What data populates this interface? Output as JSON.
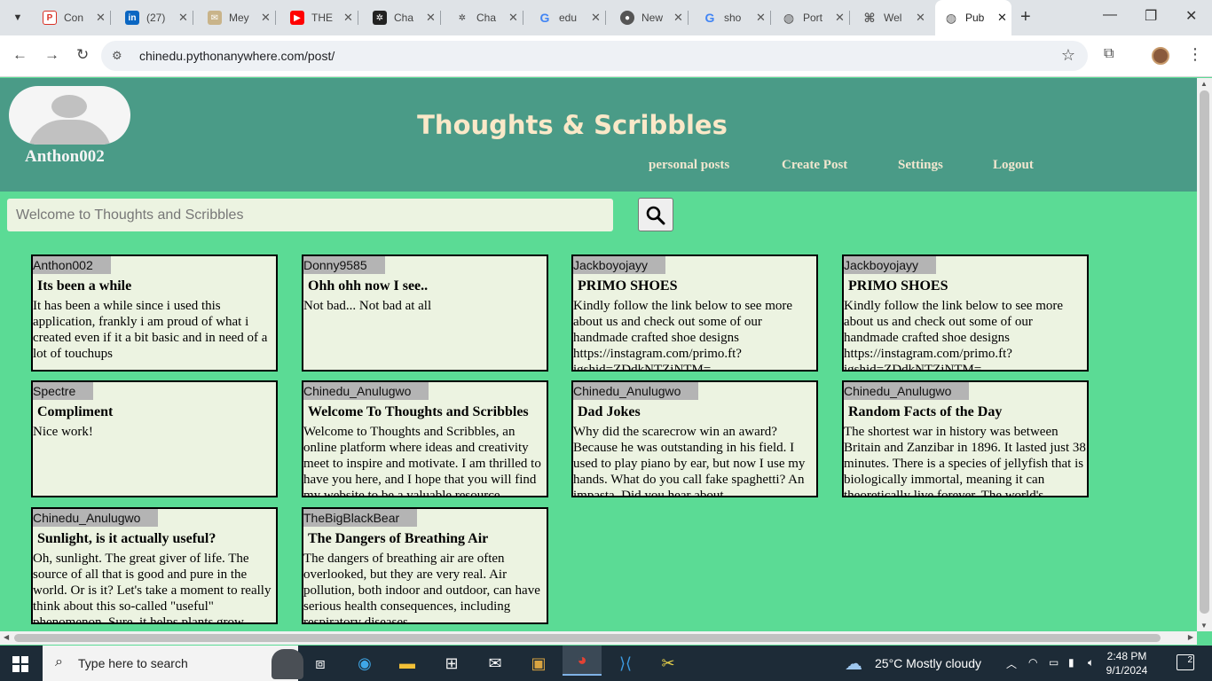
{
  "browser": {
    "tabs": [
      {
        "title": "Con",
        "icon": "pdf-icon",
        "color": "#d93025"
      },
      {
        "title": "(27)",
        "icon": "linkedin-icon",
        "color": "#0a66c2"
      },
      {
        "title": "Mey",
        "icon": "mail-icon",
        "color": "#c9b48a"
      },
      {
        "title": "THE",
        "icon": "youtube-icon",
        "color": "#ff0000"
      },
      {
        "title": "Cha",
        "icon": "chatgpt-icon",
        "color": "#222222"
      },
      {
        "title": "Cha",
        "icon": "chatgpt-icon",
        "color": "#555555"
      },
      {
        "title": "edu",
        "icon": "google-icon",
        "color": "#4285f4"
      },
      {
        "title": "New",
        "icon": "chrome-icon",
        "color": "#555555"
      },
      {
        "title": "sho",
        "icon": "google-icon",
        "color": "#4285f4"
      },
      {
        "title": "Port",
        "icon": "globe-icon",
        "color": "#555555"
      },
      {
        "title": "Wel",
        "icon": "replit-icon",
        "color": "#555555"
      },
      {
        "title": "Pub",
        "icon": "globe-icon",
        "color": "#555555",
        "active": true
      }
    ],
    "url": "chinedu.pythonanywhere.com/post/"
  },
  "header": {
    "username": "Anthon002",
    "site_title": "Thoughts & Scribbles",
    "nav": [
      "personal posts",
      "Create Post",
      "Settings",
      "Logout"
    ]
  },
  "search": {
    "placeholder": "Welcome to Thoughts and Scribbles"
  },
  "posts": [
    {
      "author": "Anthon002",
      "title": "Its been a while",
      "body": "It has been a while since i used this application, frankly i am proud of what i created even if it a bit basic and in need of a lot of touchups"
    },
    {
      "author": "Donny9585",
      "title": "Ohh ohh now I see..",
      "body": "Not bad... Not bad at all"
    },
    {
      "author": "Jackboyojayy",
      "title": "PRIMO SHOES",
      "body": "Kindly follow the link below to see more about us and check out some of our handmade crafted shoe designs https://instagram.com/primo.ft?igshid=ZDdkNTZiNTM="
    },
    {
      "author": "Jackboyojayy",
      "title": "PRIMO SHOES",
      "body": "Kindly follow the link below to see more about us and check out some of our handmade crafted shoe designs https://instagram.com/primo.ft?igshid=ZDdkNTZiNTM="
    },
    {
      "author": "Spectre",
      "title": "Compliment",
      "body": "Nice work!"
    },
    {
      "author": "Chinedu_Anulugwo",
      "title": "Welcome To Thoughts and Scribbles",
      "body": "Welcome to Thoughts and Scribbles, an online platform where ideas and creativity meet to inspire and motivate. I am thrilled to have you here, and I hope that you will find my website to be a valuable resource"
    },
    {
      "author": "Chinedu_Anulugwo",
      "title": "Dad Jokes",
      "body": "Why did the scarecrow win an award? Because he was outstanding in his field. I used to play piano by ear, but now I use my hands. What do you call fake spaghetti? An impasta. Did you hear about"
    },
    {
      "author": "Chinedu_Anulugwo",
      "title": "Random Facts of the Day",
      "body": "The shortest war in history was between Britain and Zanzibar in 1896. It lasted just 38 minutes. There is a species of jellyfish that is biologically immortal, meaning it can theoretically live forever. The world's"
    },
    {
      "author": "Chinedu_Anulugwo",
      "title": "Sunlight, is it actually useful?",
      "body": "Oh, sunlight. The great giver of life. The source of all that is good and pure in the world. Or is it? Let's take a moment to really think about this so-called \"useful\" phenomenon. Sure, it helps plants grow"
    },
    {
      "author": "TheBigBlackBear",
      "title": "The Dangers of Breathing Air",
      "body": "The dangers of breathing air are often overlooked, but they are very real. Air pollution, both indoor and outdoor, can have serious health consequences, including respiratory diseases"
    }
  ],
  "taskbar": {
    "search_placeholder": "Type here to search",
    "weather": "25°C  Mostly cloudy",
    "time": "2:48 PM",
    "date": "9/1/2024",
    "notifications": "2"
  },
  "colors": {
    "page_bg": "#5bdb95",
    "header_bg": "#4a9b87",
    "card_bg": "#ecf3e1",
    "title_color": "#fae8c8"
  }
}
